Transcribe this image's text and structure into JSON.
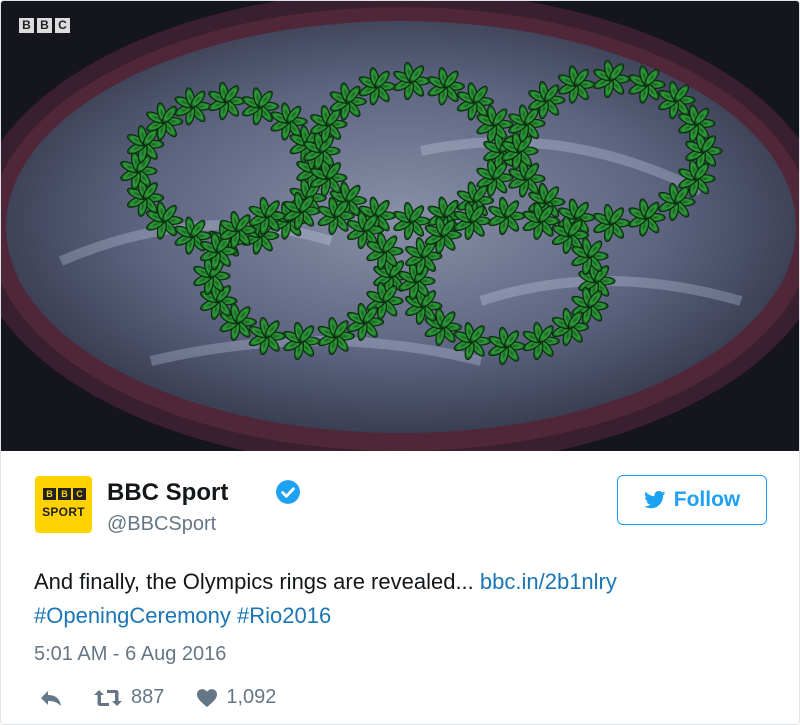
{
  "media": {
    "watermark_letters": [
      "B",
      "B",
      "C"
    ],
    "alt_icon": "olympic-rings-palm-trees-image"
  },
  "author": {
    "display_name": "BBC Sport",
    "handle": "@BBCSport",
    "avatar_letters": [
      "B",
      "B",
      "C"
    ],
    "avatar_label": "SPORT",
    "avatar_color": "#ffd200",
    "verified_icon": "verified-badge-icon"
  },
  "follow": {
    "label": "Follow",
    "icon": "bird-icon",
    "color": "#1da1f2"
  },
  "tweet": {
    "text": "And finally, the Olympics rings are revealed... ",
    "link": "bbc.in/2b1nlry",
    "hashtags": [
      "#OpeningCeremony",
      "#Rio2016"
    ],
    "timestamp": "5:01 AM - 6 Aug 2016",
    "link_color": "#1b76b5"
  },
  "actions": {
    "reply_icon": "reply-icon",
    "retweet_icon": "retweet-icon",
    "retweet_count": "887",
    "like_icon": "heart-icon",
    "like_count": "1,092"
  }
}
